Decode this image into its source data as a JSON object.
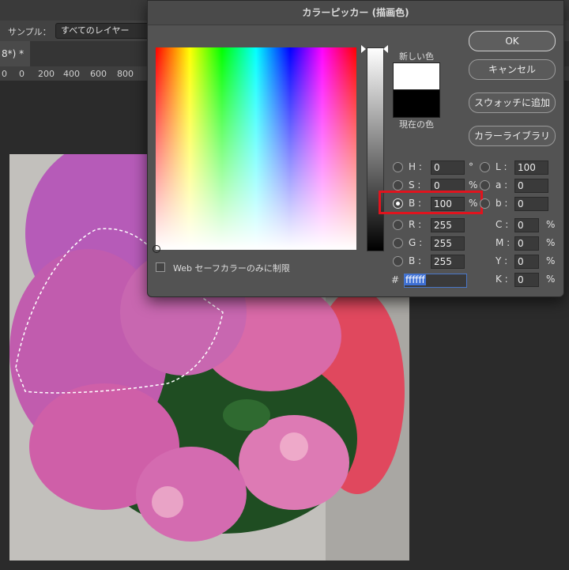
{
  "app": {
    "tab_label": "8*) *",
    "options": {
      "sample_label": "サンプル：",
      "sample_value": "すべてのレイヤー"
    },
    "ruler": [
      "0",
      "0",
      "200",
      "400",
      "600",
      "800"
    ]
  },
  "dialog": {
    "title": "カラーピッカー (描画色)",
    "new_color_label": "新しい色",
    "current_color_label": "現在の色",
    "new_color": "#ffffff",
    "current_color": "#000000",
    "buttons": {
      "ok": "OK",
      "cancel": "キャンセル",
      "add_swatch": "スウォッチに追加",
      "library": "カラーライブラリ"
    },
    "hsb": [
      {
        "label": "H :",
        "value": "0",
        "unit": "°"
      },
      {
        "label": "S :",
        "value": "0",
        "unit": "%"
      },
      {
        "label": "B :",
        "value": "100",
        "unit": "%"
      }
    ],
    "rgb": [
      {
        "label": "R :",
        "value": "255"
      },
      {
        "label": "G :",
        "value": "255"
      },
      {
        "label": "B :",
        "value": "255"
      }
    ],
    "lab": [
      {
        "label": "L :",
        "value": "100"
      },
      {
        "label": "a :",
        "value": "0"
      },
      {
        "label": "b :",
        "value": "0"
      }
    ],
    "cmyk": [
      {
        "label": "C :",
        "value": "0",
        "unit": "%"
      },
      {
        "label": "M :",
        "value": "0",
        "unit": "%"
      },
      {
        "label": "Y :",
        "value": "0",
        "unit": "%"
      },
      {
        "label": "K :",
        "value": "0",
        "unit": "%"
      }
    ],
    "hex_label": "#",
    "hex_value": "ffffff",
    "web_safe_label": "Web セーフカラーのみに制限"
  },
  "colors": {
    "highlight": "#e0141e",
    "dialog_bg": "#535353"
  }
}
